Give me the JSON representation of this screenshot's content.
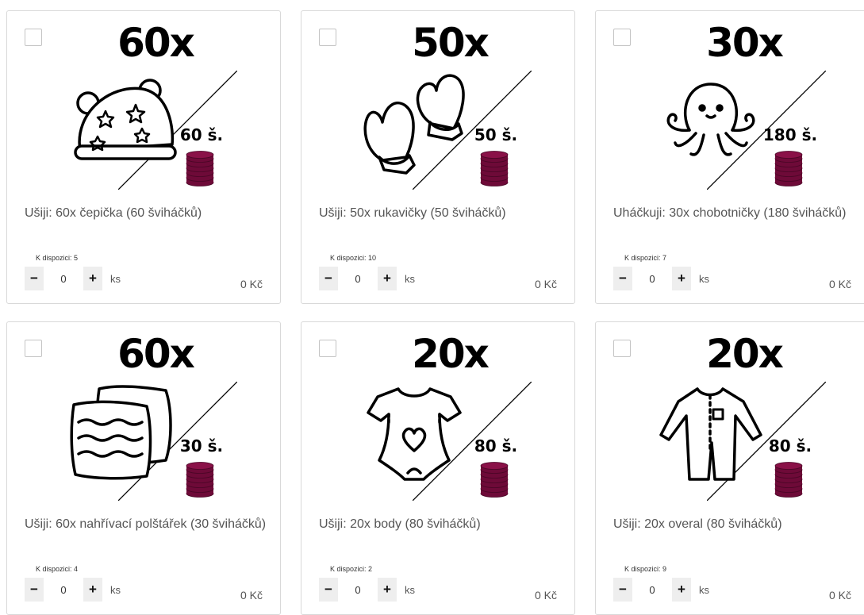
{
  "currency_icon": "coin-stack-icon",
  "accent_color": "#6e0a38",
  "products": [
    {
      "id": "cepicka",
      "qty_header": "60x",
      "price_label": "60 š.",
      "title": "Ušiji: 60x čepička (60 šviháčků)",
      "availability": "K dispozici: 5",
      "quantity": "0",
      "unit": "ks",
      "total": "0 Kč",
      "icon": "hat-icon",
      "decrement": "−",
      "increment": "+"
    },
    {
      "id": "rukavicky",
      "qty_header": "50x",
      "price_label": "50 š.",
      "title": "Ušiji: 50x rukavičky (50 šviháčků)",
      "availability": "K dispozici: 10",
      "quantity": "0",
      "unit": "ks",
      "total": "0 Kč",
      "icon": "mittens-icon",
      "decrement": "−",
      "increment": "+"
    },
    {
      "id": "chobotnicky",
      "qty_header": "30x",
      "price_label": "180 š.",
      "title": "Uháčkuji: 30x chobotničky (180 šviháčků)",
      "availability": "K dispozici: 7",
      "quantity": "0",
      "unit": "ks",
      "total": "0 Kč",
      "icon": "octopus-icon",
      "decrement": "−",
      "increment": "+"
    },
    {
      "id": "polstarek",
      "qty_header": "60x",
      "price_label": "30 š.",
      "title": "Ušiji: 60x nahřívací polštářek (30 šviháčků)",
      "availability": "K dispozici: 4",
      "quantity": "0",
      "unit": "ks",
      "total": "0 Kč",
      "icon": "pillows-icon",
      "decrement": "−",
      "increment": "+"
    },
    {
      "id": "body",
      "qty_header": "20x",
      "price_label": "80 š.",
      "title": "Ušiji: 20x body (80 šviháčků)",
      "availability": "K dispozici: 2",
      "quantity": "0",
      "unit": "ks",
      "total": "0 Kč",
      "icon": "baby-bodysuit-icon",
      "decrement": "−",
      "increment": "+"
    },
    {
      "id": "overal",
      "qty_header": "20x",
      "price_label": "80 š.",
      "title": "Ušiji: 20x overal (80 šviháčků)",
      "availability": "K dispozici: 9",
      "quantity": "0",
      "unit": "ks",
      "total": "0 Kč",
      "icon": "baby-overall-icon",
      "decrement": "−",
      "increment": "+"
    }
  ]
}
